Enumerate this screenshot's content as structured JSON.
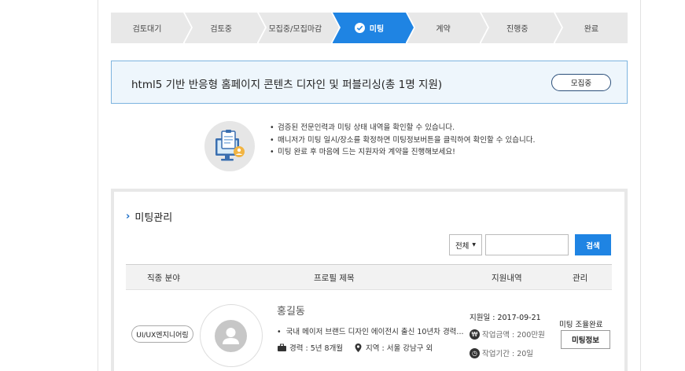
{
  "steps": [
    {
      "label": "검토대기"
    },
    {
      "label": "검토중"
    },
    {
      "label": "모집중/모집마감"
    },
    {
      "label": "미팅"
    },
    {
      "label": "계약"
    },
    {
      "label": "진행중"
    },
    {
      "label": "완료"
    }
  ],
  "active_step_index": 3,
  "banner": {
    "title": "html5 기반 반응형 홈페이지 콘텐츠 디자인 및 퍼블리싱(총 1명 지원)",
    "status_label": "모집중"
  },
  "info": {
    "items": [
      "검증된 전문인력과 미팅 상태 내역을 확인할 수 있습니다.",
      "매니저가 미팅 일시/장소를 확정하면 미팅정보버튼을 클릭하여 확인할 수 있습니다.",
      "미팅 완료 후 마음에 드는 지원자와 계약을 진행해보세요!"
    ]
  },
  "mgmt": {
    "title": "미팅관리",
    "filter_selected": "전체",
    "search_value": "",
    "search_button": "검색",
    "columns": [
      "직종 분야",
      "프로필 제목",
      "지원내역",
      "관리"
    ]
  },
  "rows": [
    {
      "category": "UI/UX엔지니어링",
      "name": "홍길동",
      "summary": "국내 메이저 브랜드 디자인 에이전시 출신 10년차 경력...",
      "career": "경력 : 5년 8개월",
      "region": "지역 : 서울 강남구 외",
      "apply_date": "지원일 : 2017-09-21",
      "fee": "작업금액 : 200만원",
      "period": "작업기간 : 20일",
      "meeting_status": "미팅 조율완료",
      "meeting_button": "미팅정보"
    }
  ],
  "colors": {
    "accent": "#1f84e3",
    "step_inactive": "#e8e8e8",
    "banner_bg": "#eef6fc",
    "banner_border": "#7db4df"
  }
}
